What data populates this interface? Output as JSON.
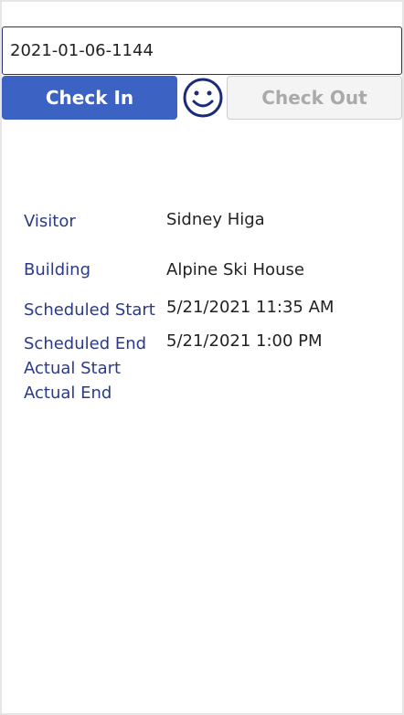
{
  "checkin": {
    "code_value": "2021-01-06-1144",
    "check_in_label": "Check In",
    "check_out_label": "Check Out",
    "status_icon": "smiley-face-icon"
  },
  "details": {
    "visitor_label": "Visitor",
    "visitor_value": "Sidney Higa",
    "building_label": "Building",
    "building_value": "Alpine Ski House",
    "scheduled_start_label": "Scheduled Start",
    "scheduled_start_value": "5/21/2021 11:35 AM",
    "scheduled_end_label": "Scheduled End",
    "scheduled_end_value": "5/21/2021 1:00 PM",
    "actual_start_label": "Actual Start",
    "actual_end_label": "Actual End"
  },
  "colors": {
    "primary": "#3c62c4",
    "label_text": "#2a3a8a",
    "icon": "#1c2a7a"
  }
}
